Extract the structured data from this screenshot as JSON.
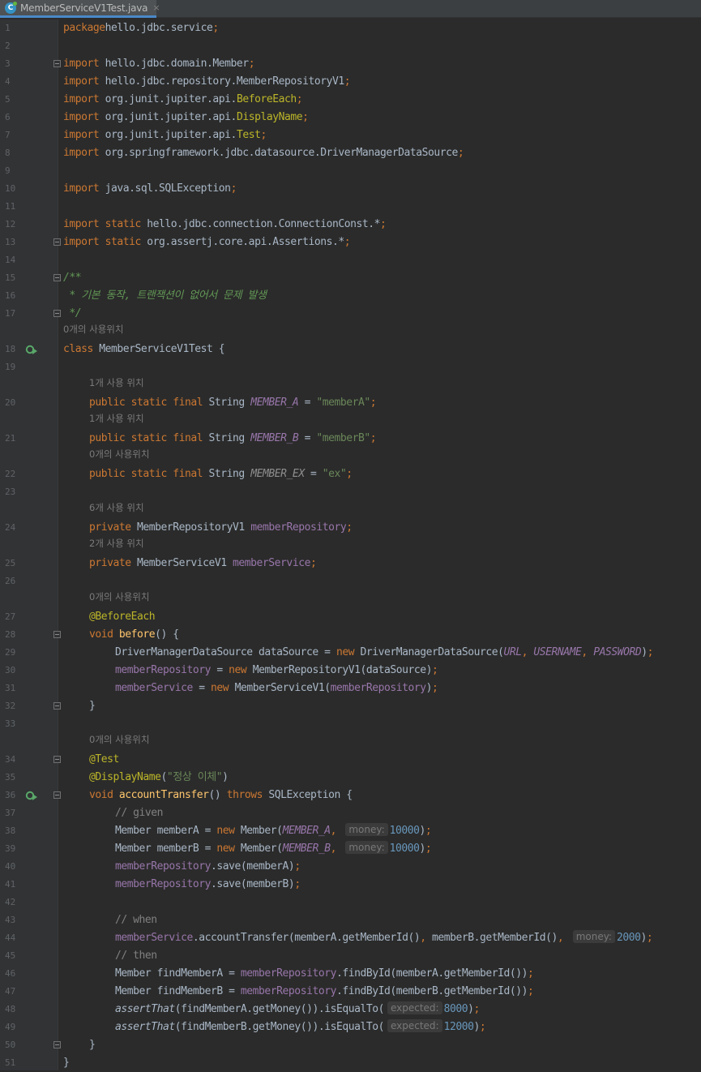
{
  "tab": {
    "filename": "MemberServiceV1Test.java",
    "icon_letter": "C",
    "close_glyph": "×"
  },
  "colors": {
    "background": "#2b2b2b",
    "gutter": "#313335",
    "keyword": "#cc7832",
    "annotation": "#bbb529",
    "field": "#9876aa",
    "string": "#6a8759",
    "number": "#6897bb",
    "comment": "#808080",
    "doc_comment": "#629755",
    "method_decl": "#ffc66d"
  },
  "lines": [
    {
      "n": "1",
      "indent": 0,
      "parts": [
        [
          "k",
          "package"
        ],
        [
          "",
          "hello.jdbc.service"
        ],
        [
          "k",
          ";"
        ]
      ]
    },
    {
      "n": "2",
      "indent": 0,
      "parts": []
    },
    {
      "n": "3",
      "indent": 0,
      "fold": true,
      "parts": [
        [
          "k",
          "import"
        ],
        [
          "",
          " hello.jdbc.domain.Member"
        ],
        [
          "k",
          ";"
        ]
      ]
    },
    {
      "n": "4",
      "indent": 0,
      "parts": [
        [
          "k",
          "import"
        ],
        [
          "",
          " hello.jdbc.repository.MemberRepositoryV1"
        ],
        [
          "k",
          ";"
        ]
      ]
    },
    {
      "n": "5",
      "indent": 0,
      "parts": [
        [
          "k",
          "import"
        ],
        [
          "",
          " org.junit.jupiter.api."
        ],
        [
          "pk",
          "BeforeEach"
        ],
        [
          "k",
          ";"
        ]
      ]
    },
    {
      "n": "6",
      "indent": 0,
      "parts": [
        [
          "k",
          "import"
        ],
        [
          "",
          " org.junit.jupiter.api."
        ],
        [
          "pk",
          "DisplayName"
        ],
        [
          "k",
          ";"
        ]
      ]
    },
    {
      "n": "7",
      "indent": 0,
      "parts": [
        [
          "k",
          "import"
        ],
        [
          "",
          " org.junit.jupiter.api."
        ],
        [
          "pk",
          "Test"
        ],
        [
          "k",
          ";"
        ]
      ]
    },
    {
      "n": "8",
      "indent": 0,
      "parts": [
        [
          "k",
          "import"
        ],
        [
          "",
          " org.springframework.jdbc.datasource.DriverManagerDataSource"
        ],
        [
          "k",
          ";"
        ]
      ]
    },
    {
      "n": "9",
      "indent": 0,
      "parts": []
    },
    {
      "n": "10",
      "indent": 0,
      "parts": [
        [
          "k",
          "import"
        ],
        [
          "",
          " java.sql.SQLException"
        ],
        [
          "k",
          ";"
        ]
      ]
    },
    {
      "n": "11",
      "indent": 0,
      "parts": []
    },
    {
      "n": "12",
      "indent": 0,
      "parts": [
        [
          "k",
          "import static"
        ],
        [
          "",
          " hello.jdbc.connection.ConnectionConst.*"
        ],
        [
          "k",
          ";"
        ]
      ]
    },
    {
      "n": "13",
      "indent": 0,
      "fold": true,
      "parts": [
        [
          "k",
          "import static"
        ],
        [
          "",
          " org.assertj.core.api.Assertions.*"
        ],
        [
          "k",
          ";"
        ]
      ]
    },
    {
      "n": "14",
      "indent": 0,
      "parts": []
    },
    {
      "n": "15",
      "indent": 0,
      "fold": true,
      "parts": [
        [
          "doc",
          "/**"
        ]
      ]
    },
    {
      "n": "16",
      "indent": 0,
      "parts": [
        [
          "doc",
          " * 기본 동작, 트랜잭션이 없어서 문제 발생"
        ]
      ]
    },
    {
      "n": "17",
      "indent": 0,
      "fold": true,
      "parts": [
        [
          "doc",
          " */"
        ]
      ]
    },
    {
      "hint": "0개의 사용위치",
      "indent": 0
    },
    {
      "n": "18",
      "indent": 0,
      "run": true,
      "parts": [
        [
          "k",
          "class"
        ],
        [
          "",
          " MemberServiceV1Test {"
        ]
      ]
    },
    {
      "n": "19",
      "indent": 0,
      "parts": []
    },
    {
      "hint": "1개 사용 위치",
      "indent": 1
    },
    {
      "n": "20",
      "indent": 1,
      "parts": [
        [
          "k",
          "public static final"
        ],
        [
          "",
          " String "
        ],
        [
          "sf",
          "MEMBER_A"
        ],
        [
          "",
          " = "
        ],
        [
          "st",
          "\"memberA\""
        ],
        [
          "k",
          ";"
        ]
      ]
    },
    {
      "hint": "1개 사용 위치",
      "indent": 1
    },
    {
      "n": "21",
      "indent": 1,
      "parts": [
        [
          "k",
          "public static final"
        ],
        [
          "",
          " String "
        ],
        [
          "sf",
          "MEMBER_B"
        ],
        [
          "",
          " = "
        ],
        [
          "st",
          "\"memberB\""
        ],
        [
          "k",
          ";"
        ]
      ]
    },
    {
      "hint": "0개의 사용위치",
      "indent": 1
    },
    {
      "n": "22",
      "indent": 1,
      "parts": [
        [
          "k",
          "public static final"
        ],
        [
          "",
          " String "
        ],
        [
          "sfg",
          "MEMBER_EX"
        ],
        [
          "",
          " = "
        ],
        [
          "st",
          "\"ex\""
        ],
        [
          "k",
          ";"
        ]
      ]
    },
    {
      "n": "23",
      "indent": 0,
      "parts": []
    },
    {
      "hint": "6개 사용 위치",
      "indent": 1
    },
    {
      "n": "24",
      "indent": 1,
      "parts": [
        [
          "k",
          "private"
        ],
        [
          "",
          " MemberRepositoryV1 "
        ],
        [
          "fd",
          "memberRepository"
        ],
        [
          "k",
          ";"
        ]
      ]
    },
    {
      "hint": "2개 사용 위치",
      "indent": 1
    },
    {
      "n": "25",
      "indent": 1,
      "parts": [
        [
          "k",
          "private"
        ],
        [
          "",
          " MemberServiceV1 "
        ],
        [
          "fd",
          "memberService"
        ],
        [
          "k",
          ";"
        ]
      ]
    },
    {
      "n": "26",
      "indent": 0,
      "parts": []
    },
    {
      "hint": "0개의 사용위치",
      "indent": 1
    },
    {
      "n": "27",
      "indent": 1,
      "parts": [
        [
          "an",
          "@BeforeEach"
        ]
      ]
    },
    {
      "n": "28",
      "indent": 1,
      "fold": true,
      "parts": [
        [
          "k",
          "void "
        ],
        [
          "fn",
          "before"
        ],
        [
          "",
          "() {"
        ]
      ]
    },
    {
      "n": "29",
      "indent": 2,
      "parts": [
        [
          "",
          "DriverManagerDataSource dataSource = "
        ],
        [
          "k",
          "new "
        ],
        [
          "",
          "DriverManagerDataSource("
        ],
        [
          "sf",
          "URL"
        ],
        [
          "k",
          ", "
        ],
        [
          "sf",
          "USERNAME"
        ],
        [
          "k",
          ", "
        ],
        [
          "sf",
          "PASSWORD"
        ],
        [
          "",
          ")"
        ],
        [
          "k",
          ";"
        ]
      ]
    },
    {
      "n": "30",
      "indent": 2,
      "parts": [
        [
          "fd",
          "memberRepository"
        ],
        [
          "",
          " = "
        ],
        [
          "k",
          "new "
        ],
        [
          "",
          "MemberRepositoryV1(dataSource)"
        ],
        [
          "k",
          ";"
        ]
      ]
    },
    {
      "n": "31",
      "indent": 2,
      "parts": [
        [
          "fd",
          "memberService"
        ],
        [
          "",
          " = "
        ],
        [
          "k",
          "new "
        ],
        [
          "",
          "MemberServiceV1("
        ],
        [
          "fd",
          "memberRepository"
        ],
        [
          "",
          ")"
        ],
        [
          "k",
          ";"
        ]
      ]
    },
    {
      "n": "32",
      "indent": 1,
      "fold": true,
      "parts": [
        [
          "",
          "}"
        ]
      ]
    },
    {
      "n": "33",
      "indent": 0,
      "parts": []
    },
    {
      "hint": "0개의 사용위치",
      "indent": 1
    },
    {
      "n": "34",
      "indent": 1,
      "fold": true,
      "parts": [
        [
          "an",
          "@Test"
        ]
      ]
    },
    {
      "n": "35",
      "indent": 1,
      "parts": [
        [
          "an",
          "@DisplayName"
        ],
        [
          "",
          "("
        ],
        [
          "st",
          "\"정상 이체\""
        ],
        [
          "",
          ")"
        ]
      ]
    },
    {
      "n": "36",
      "indent": 1,
      "run": true,
      "fold": true,
      "parts": [
        [
          "k",
          "void "
        ],
        [
          "fn",
          "accountTransfer"
        ],
        [
          "",
          "() "
        ],
        [
          "k",
          "throws "
        ],
        [
          "",
          "SQLException {"
        ]
      ]
    },
    {
      "n": "37",
      "indent": 2,
      "parts": [
        [
          "cm",
          "// given"
        ]
      ]
    },
    {
      "n": "38",
      "indent": 2,
      "parts": [
        [
          "",
          "Member memberA = "
        ],
        [
          "k",
          "new "
        ],
        [
          "",
          "Member("
        ],
        [
          "sf",
          "MEMBER_A"
        ],
        [
          "k",
          ", "
        ],
        [
          "ph",
          "money:"
        ],
        [
          "nm",
          "10000"
        ],
        [
          "",
          ")"
        ],
        [
          "k",
          ";"
        ]
      ]
    },
    {
      "n": "39",
      "indent": 2,
      "parts": [
        [
          "",
          "Member memberB = "
        ],
        [
          "k",
          "new "
        ],
        [
          "",
          "Member("
        ],
        [
          "sf",
          "MEMBER_B"
        ],
        [
          "k",
          ", "
        ],
        [
          "ph",
          "money:"
        ],
        [
          "nm",
          "10000"
        ],
        [
          "",
          ")"
        ],
        [
          "k",
          ";"
        ]
      ]
    },
    {
      "n": "40",
      "indent": 2,
      "parts": [
        [
          "fd",
          "memberRepository"
        ],
        [
          "",
          ".save(memberA)"
        ],
        [
          "k",
          ";"
        ]
      ]
    },
    {
      "n": "41",
      "indent": 2,
      "parts": [
        [
          "fd",
          "memberRepository"
        ],
        [
          "",
          ".save(memberB)"
        ],
        [
          "k",
          ";"
        ]
      ]
    },
    {
      "n": "42",
      "indent": 0,
      "parts": []
    },
    {
      "n": "43",
      "indent": 2,
      "parts": [
        [
          "cm",
          "// when"
        ]
      ]
    },
    {
      "n": "44",
      "indent": 2,
      "parts": [
        [
          "fd",
          "memberService"
        ],
        [
          "",
          ".accountTransfer(memberA.getMemberId()"
        ],
        [
          "k",
          ", "
        ],
        [
          "",
          "memberB.getMemberId()"
        ],
        [
          "k",
          ", "
        ],
        [
          "ph",
          "money:"
        ],
        [
          "nm",
          "2000"
        ],
        [
          "",
          ")"
        ],
        [
          "k",
          ";"
        ]
      ]
    },
    {
      "n": "45",
      "indent": 2,
      "parts": [
        [
          "cm",
          "// then"
        ]
      ]
    },
    {
      "n": "46",
      "indent": 2,
      "parts": [
        [
          "",
          "Member findMemberA = "
        ],
        [
          "fd",
          "memberRepository"
        ],
        [
          "",
          ".findById(memberA.getMemberId())"
        ],
        [
          "k",
          ";"
        ]
      ]
    },
    {
      "n": "47",
      "indent": 2,
      "parts": [
        [
          "",
          "Member findMemberB = "
        ],
        [
          "fd",
          "memberRepository"
        ],
        [
          "",
          ".findById(memberB.getMemberId())"
        ],
        [
          "k",
          ";"
        ]
      ]
    },
    {
      "n": "48",
      "indent": 2,
      "parts": [
        [
          "smi",
          "assertThat"
        ],
        [
          "",
          "(findMemberA.getMoney()).isEqualTo("
        ],
        [
          "ph",
          "expected:"
        ],
        [
          "nm",
          "8000"
        ],
        [
          "",
          ")"
        ],
        [
          "k",
          ";"
        ]
      ]
    },
    {
      "n": "49",
      "indent": 2,
      "parts": [
        [
          "smi",
          "assertThat"
        ],
        [
          "",
          "(findMemberB.getMoney()).isEqualTo("
        ],
        [
          "ph",
          "expected:"
        ],
        [
          "nm",
          "12000"
        ],
        [
          "",
          ")"
        ],
        [
          "k",
          ";"
        ]
      ]
    },
    {
      "n": "50",
      "indent": 1,
      "fold": true,
      "parts": [
        [
          "",
          "}"
        ]
      ]
    },
    {
      "n": "51",
      "indent": 0,
      "parts": [
        [
          "",
          "}"
        ]
      ]
    }
  ]
}
